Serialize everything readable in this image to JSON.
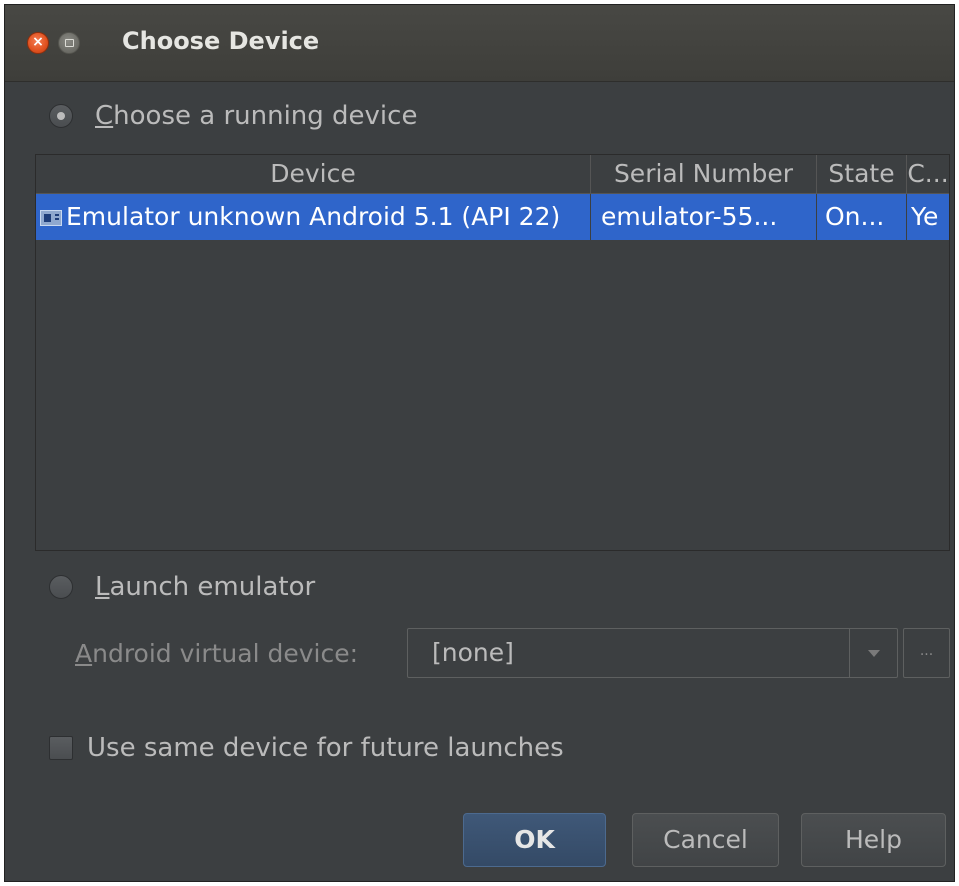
{
  "window": {
    "title": "Choose Device",
    "close_glyph": "×"
  },
  "running": {
    "label_underlined": "C",
    "label_rest": "hoose a running device",
    "selected": true
  },
  "table": {
    "columns": [
      "Device",
      "Serial Number",
      "State",
      "C..."
    ],
    "rows": [
      {
        "device": "Emulator unknown Android 5.1 (API 22)",
        "serial": "emulator-55...",
        "state": "On...",
        "compatible": "Ye"
      }
    ],
    "selection_color": "#2f65ca"
  },
  "launch": {
    "label_underlined": "L",
    "label_rest": "aunch emulator",
    "selected": false
  },
  "avd": {
    "label_underlined": "A",
    "label_rest": "ndroid virtual device:",
    "value": "[none]",
    "ellipsis": "..."
  },
  "future": {
    "label": "Use same device for future launches",
    "checked": false
  },
  "buttons": {
    "ok": "OK",
    "cancel": "Cancel",
    "help": "Help"
  }
}
